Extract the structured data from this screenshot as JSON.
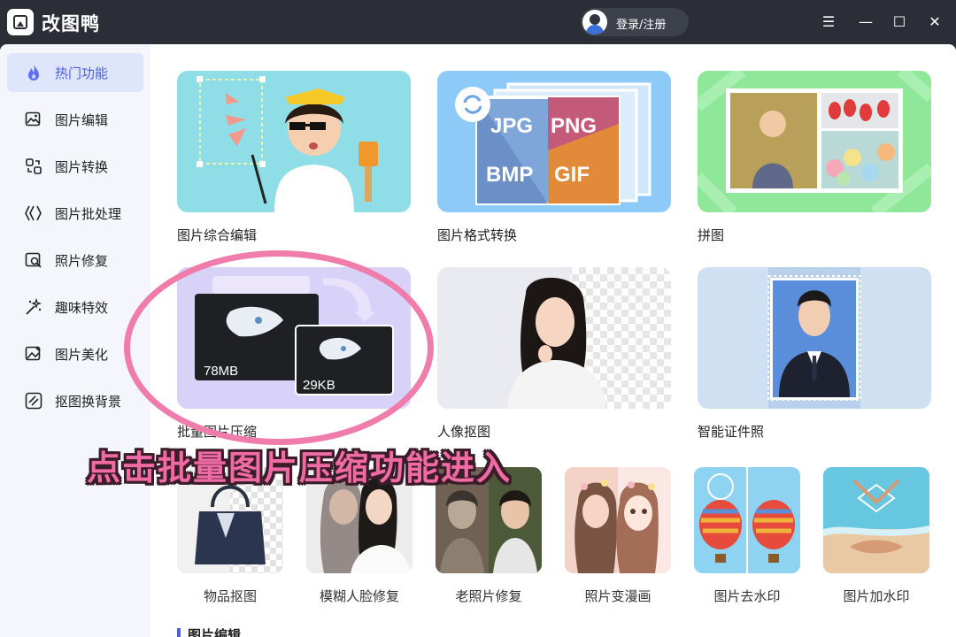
{
  "app": {
    "title": "改图鸭",
    "login_label": "登录/注册"
  },
  "window_controls": {
    "menu": "☰",
    "minimize": "—",
    "maximize": "☐",
    "close": "✕"
  },
  "sidebar": {
    "items": [
      {
        "label": "热门功能",
        "icon": "flame-icon",
        "active": true
      },
      {
        "label": "图片编辑",
        "icon": "image-edit-icon"
      },
      {
        "label": "图片转换",
        "icon": "convert-icon"
      },
      {
        "label": "图片批处理",
        "icon": "batch-icon"
      },
      {
        "label": "照片修复",
        "icon": "photo-repair-icon"
      },
      {
        "label": "趣味特效",
        "icon": "magic-wand-icon"
      },
      {
        "label": "图片美化",
        "icon": "beautify-icon"
      },
      {
        "label": "抠图换背景",
        "icon": "cutout-icon"
      }
    ]
  },
  "cards": {
    "row1": [
      "图片综合编辑",
      "图片格式转换",
      "拼图"
    ],
    "row2": [
      "批量图片压缩",
      "人像抠图",
      "智能证件照"
    ],
    "row3": [
      "物品抠图",
      "模糊人脸修复",
      "老照片修复",
      "照片变漫画",
      "图片去水印",
      "图片加水印"
    ]
  },
  "format_tiles": [
    "JPG",
    "PNG",
    "BMP",
    "GIF"
  ],
  "compress": {
    "before_size": "78MB",
    "after_size": "29KB"
  },
  "section_next": "图片编辑",
  "annotation": {
    "text": "点击批量图片压缩功能进入",
    "color": "#f06aa3"
  },
  "colors": {
    "accent": "#4b5fe0",
    "titlebar": "#2b2e36"
  }
}
